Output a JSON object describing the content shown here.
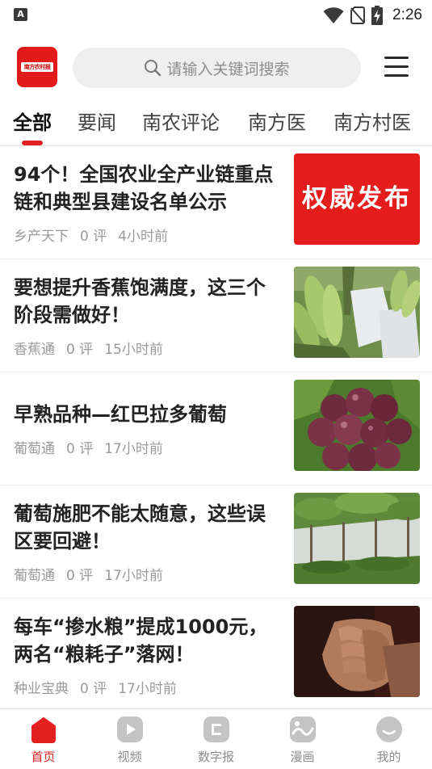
{
  "status_bar": {
    "app_icon_letter": "A",
    "time": "2:26"
  },
  "header": {
    "logo_text": "南方农村报",
    "search_placeholder": "请输入关键词搜索"
  },
  "tabs": [
    {
      "label": "全部",
      "active": true
    },
    {
      "label": "要闻",
      "active": false
    },
    {
      "label": "南农评论",
      "active": false
    },
    {
      "label": "南方医",
      "active": false
    },
    {
      "label": "南方村医",
      "active": false
    }
  ],
  "news": [
    {
      "title": "94个！全国农业全产业链重点链和典型县建设名单公示",
      "source": "乡产天下",
      "comments": "0 评",
      "time": "4小时前",
      "thumb_text": "权威发布"
    },
    {
      "title": "要想提升香蕉饱满度，这三个阶段需做好！",
      "source": "香蕉通",
      "comments": "0 评",
      "time": "15小时前"
    },
    {
      "title": "早熟品种—红巴拉多葡萄",
      "source": "葡萄通",
      "comments": "0 评",
      "time": "17小时前"
    },
    {
      "title": "葡萄施肥不能太随意，这些误区要回避！",
      "source": "葡萄通",
      "comments": "0 评",
      "time": "17小时前"
    },
    {
      "title": "每车“掺水粮”提成1000元，两名“粮耗子”落网！",
      "source": "种业宝典",
      "comments": "0 评",
      "time": "17小时前"
    }
  ],
  "bottom_nav": [
    {
      "label": "首页",
      "icon": "home-icon",
      "active": true
    },
    {
      "label": "视频",
      "icon": "video-icon",
      "active": false
    },
    {
      "label": "数字报",
      "icon": "newspaper-icon",
      "active": false
    },
    {
      "label": "漫画",
      "icon": "comic-icon",
      "active": false
    },
    {
      "label": "我的",
      "icon": "profile-icon",
      "active": false
    }
  ],
  "colors": {
    "accent": "#e52020",
    "brand_red": "#e21a1a",
    "inactive_icon": "#c4c4c4"
  }
}
